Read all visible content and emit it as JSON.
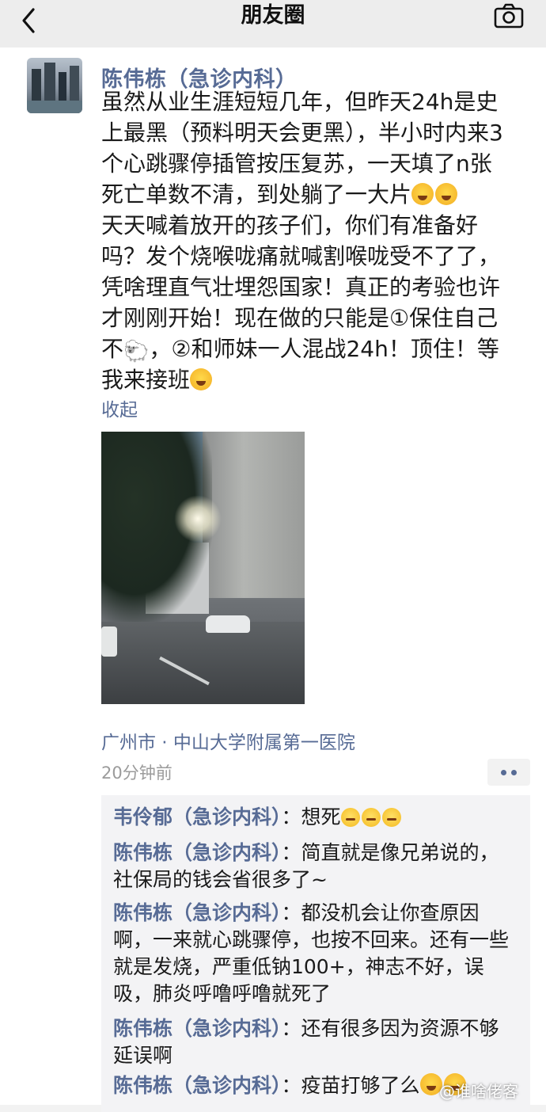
{
  "header": {
    "title": "朋友圈"
  },
  "post": {
    "author": "陈伟栋（急诊内科）",
    "lines": [
      "虽然从业生涯短短几年，但昨天24h是史",
      "上最黑（预料明天会更黑），半小时内来3",
      "个心跳骤停插管按压复苏，一天填了n张",
      "死亡单数不清，到处躺了一大片",
      "天天喊着放开的孩子们，你们有准备好",
      "吗？发个烧喉咙痛就喊割喉咙受不了了，",
      "凭啥理直气壮埋怨国家！真正的考验也许",
      "才刚刚开始！现在做的只能是①保住自己",
      "不",
      "，②和师妹一人混战24h！顶住！等",
      "我来接班"
    ],
    "collapse_label": "收起",
    "location": "广州市 · 中山大学附属第一医院",
    "time": "20分钟前"
  },
  "comments": [
    {
      "name": "韦伶郁（急诊内科）",
      "text": "：想死"
    },
    {
      "name": "陈伟栋（急诊内科）",
      "text": "：简直就是像兄弟说的，",
      "cont": [
        "社保局的钱会省很多了~"
      ]
    },
    {
      "name": "陈伟栋（急诊内科）",
      "text": "：都没机会让你查原因",
      "cont": [
        "啊，一来就心跳骤停，也按不回来。还有一些",
        "就是发烧，严重低钠100+，神志不好，误",
        "吸，肺炎呼噜呼噜就死了"
      ]
    },
    {
      "name": "陈伟栋（急诊内科）",
      "text": "：还有很多因为资源不够",
      "cont": [
        "延误啊"
      ]
    },
    {
      "name": "陈伟栋（急诊内科）",
      "text": "：疫苗打够了么"
    }
  ],
  "watermark": "@谁啥佬客",
  "icons": {
    "back": "chevron-left-icon",
    "camera": "camera-icon",
    "emoji_laugh": "laughing-crying-emoji",
    "emoji_flush": "flushed-emoji",
    "emoji_sheep": "sheep-emoji"
  },
  "colors": {
    "link": "#576b95",
    "header_bg": "#ededed",
    "comment_bg": "#f3f3f5"
  }
}
